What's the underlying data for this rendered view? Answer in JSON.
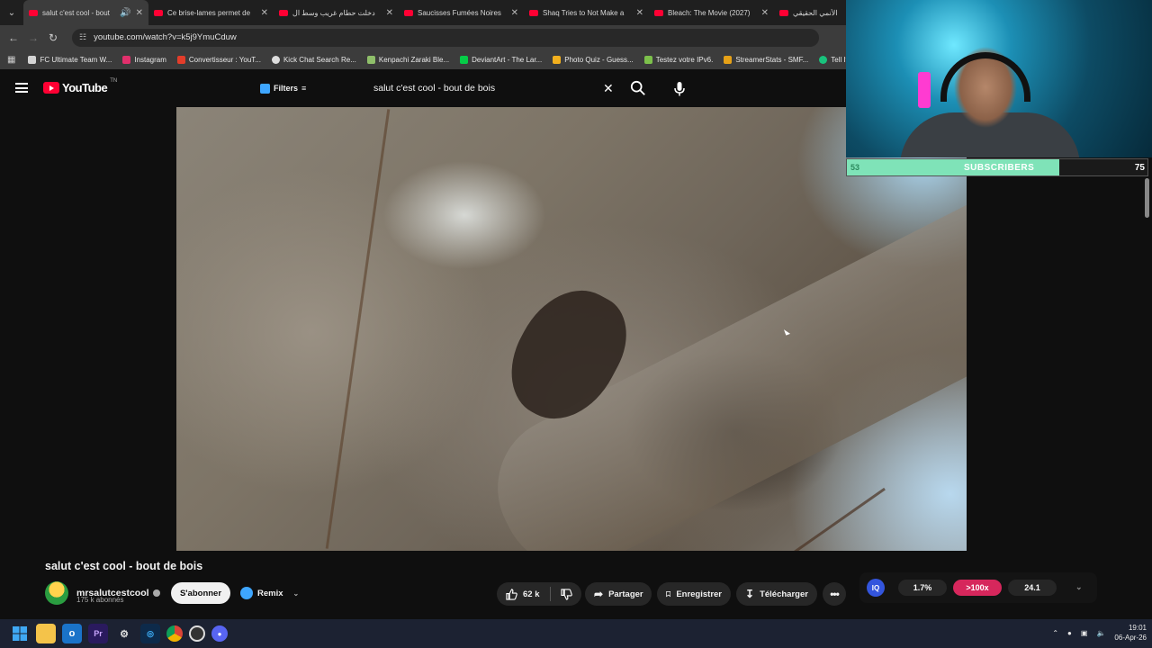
{
  "browser": {
    "tabs": [
      {
        "title": "salut c'est cool - bout",
        "active": true
      },
      {
        "title": "Ce brise-lames permet de",
        "active": false
      },
      {
        "title": "دخلت حطام غريب وسط ال",
        "active": false
      },
      {
        "title": "Saucisses Fumées Noires",
        "active": false
      },
      {
        "title": "Shaq Tries to Not Make a",
        "active": false
      },
      {
        "title": "Bleach: The Movie (2027)",
        "active": false
      },
      {
        "title": "الأنمي الحقيقي",
        "active": false
      }
    ],
    "url": "youtube.com/watch?v=k5j9YmuCduw",
    "bookmarks": [
      {
        "label": "FC Ultimate Team W...",
        "color": "#d4d4d4"
      },
      {
        "label": "Instagram",
        "color": "#e1306c"
      },
      {
        "label": "Convertisseur : YouT...",
        "color": "#e33d2a"
      },
      {
        "label": "Kick Chat Search Re...",
        "color": "#dddddd"
      },
      {
        "label": "Kenpachi Zaraki Ble...",
        "color": "#8fbf6a"
      },
      {
        "label": "DeviantArt - The Lar...",
        "color": "#05cc47"
      },
      {
        "label": "Photo Quiz - Guess...",
        "color": "#f2b01e"
      },
      {
        "label": "Testez votre IPv6.",
        "color": "#7cc04b"
      },
      {
        "label": "StreamerStats - SMF...",
        "color": "#e6a117"
      },
      {
        "label": "Tell It",
        "color": "#19c37d"
      }
    ]
  },
  "youtube": {
    "logo": "YouTube",
    "logo_sup": "TN",
    "filters_label": "Filters",
    "search_value": "salut c'est cool - bout de bois"
  },
  "stream_overlay": {
    "subs_current": "53",
    "subs_label": "SUBSCRIBERS",
    "subs_goal": "75",
    "progress": 0.707
  },
  "video": {
    "title": "salut c'est cool - bout de bois",
    "channel": "mrsalutcestcool",
    "subscribers": "175 k abonnés",
    "subscribe_label": "S'abonner",
    "remix_label": "Remix",
    "likes": "62 k",
    "share_label": "Partager",
    "save_label": "Enregistrer",
    "download_label": "Télécharger"
  },
  "extension": {
    "badge": "IQ",
    "stat1": "1.7%",
    "stat2": ">100x",
    "stat3": "24.1"
  },
  "taskbar": {
    "time": "19:01",
    "date": "06-Apr-26"
  }
}
